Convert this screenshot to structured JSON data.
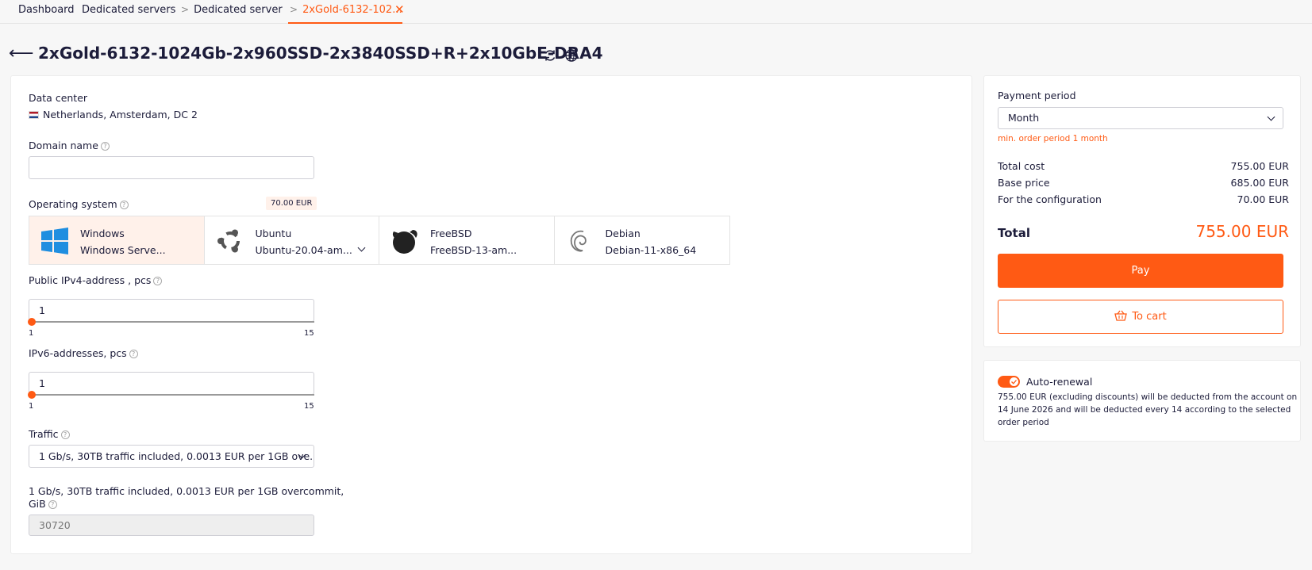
{
  "tabs": [
    {
      "label": "Dashboard"
    },
    {
      "label": "Dedicated servers"
    },
    {
      "label": "Dedicated server"
    },
    {
      "label": "2xGold-6132-102..."
    }
  ],
  "tab_separator": ">",
  "page": {
    "title": "2xGold-6132-1024Gb-2x960SSD-2x3840SSD+R+2x10GbE-DRA4"
  },
  "form": {
    "datacenter_label": "Data center",
    "datacenter_value": "Netherlands, Amsterdam, DC 2",
    "domain_label": "Domain name",
    "domain_value": "",
    "os_label": "Operating system",
    "os_price": "70.00 EUR",
    "os_options": [
      {
        "name": "Windows",
        "version": "Windows Serve..."
      },
      {
        "name": "Ubuntu",
        "version": "Ubuntu-20.04-am..."
      },
      {
        "name": "FreeBSD",
        "version": "FreeBSD-13-am..."
      },
      {
        "name": "Debian",
        "version": "Debian-11-x86_64"
      }
    ],
    "ipv4_label": "Public IPv4-address , pcs",
    "ipv4_value": "1",
    "ipv4_min": "1",
    "ipv4_max": "15",
    "ipv6_label": "IPv6-addresses, pcs",
    "ipv6_value": "1",
    "ipv6_min": "1",
    "ipv6_max": "15",
    "traffic_label": "Traffic",
    "traffic_value": "1 Gb/s, 30TB traffic included, 0.0013 EUR per 1GB ove...",
    "traffic_amount_label_line1": "1 Gb/s, 30TB traffic included, 0.0013 EUR per 1GB overcommit,",
    "traffic_amount_label_line2": "GiB",
    "traffic_amount_value": "30720"
  },
  "payment": {
    "period_label": "Payment period",
    "period_value": "Month",
    "min_order_note": "min. order period 1 month",
    "total_cost_label": "Total cost",
    "total_cost_value": "755.00 EUR",
    "base_price_label": "Base price",
    "base_price_value": "685.00 EUR",
    "config_label": "For the configuration",
    "config_value": "70.00 EUR",
    "total_label": "Total",
    "total_value": "755.00 EUR",
    "pay_label": "Pay",
    "cart_label": "To cart"
  },
  "renewal": {
    "label": "Auto-renewal",
    "enabled": true,
    "note_line1": "755.00 EUR (excluding discounts) will be deducted from the account on",
    "note_line2": "14 June 2026 and will be deducted every 14 according to the selected",
    "note_line3": "order period"
  },
  "colors": {
    "accent": "#ff5a14",
    "text": "#1c1c3a",
    "selected_bg": "#fff1ea"
  },
  "icons": [
    "back-arrow-icon",
    "refresh-icon",
    "globe-icon",
    "help-icon",
    "netherlands-flag-icon",
    "windows-logo-icon",
    "ubuntu-logo-icon",
    "freebsd-logo-icon",
    "debian-logo-icon",
    "chevron-down-icon",
    "basket-icon",
    "close-icon",
    "check-icon"
  ]
}
